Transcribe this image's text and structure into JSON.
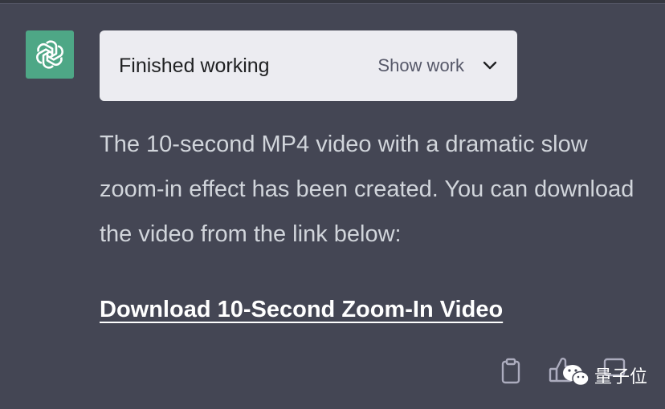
{
  "status_card": {
    "title": "Finished working",
    "show_work_label": "Show work"
  },
  "message": {
    "text": "The 10-second MP4 video with a dramatic slow zoom-in effect has been created. You can download the video from the link below:",
    "link_text": "Download 10-Second Zoom-In Video"
  },
  "actions": {
    "copy": "clipboard-icon",
    "thumbs_up": "thumbs-up-icon",
    "feedback": "edit-icon"
  },
  "watermark": {
    "text": "量子位"
  },
  "colors": {
    "background": "#444654",
    "avatar": "#4ea786",
    "card": "#ececf1",
    "text": "#d1d5db",
    "link": "#ffffff"
  }
}
